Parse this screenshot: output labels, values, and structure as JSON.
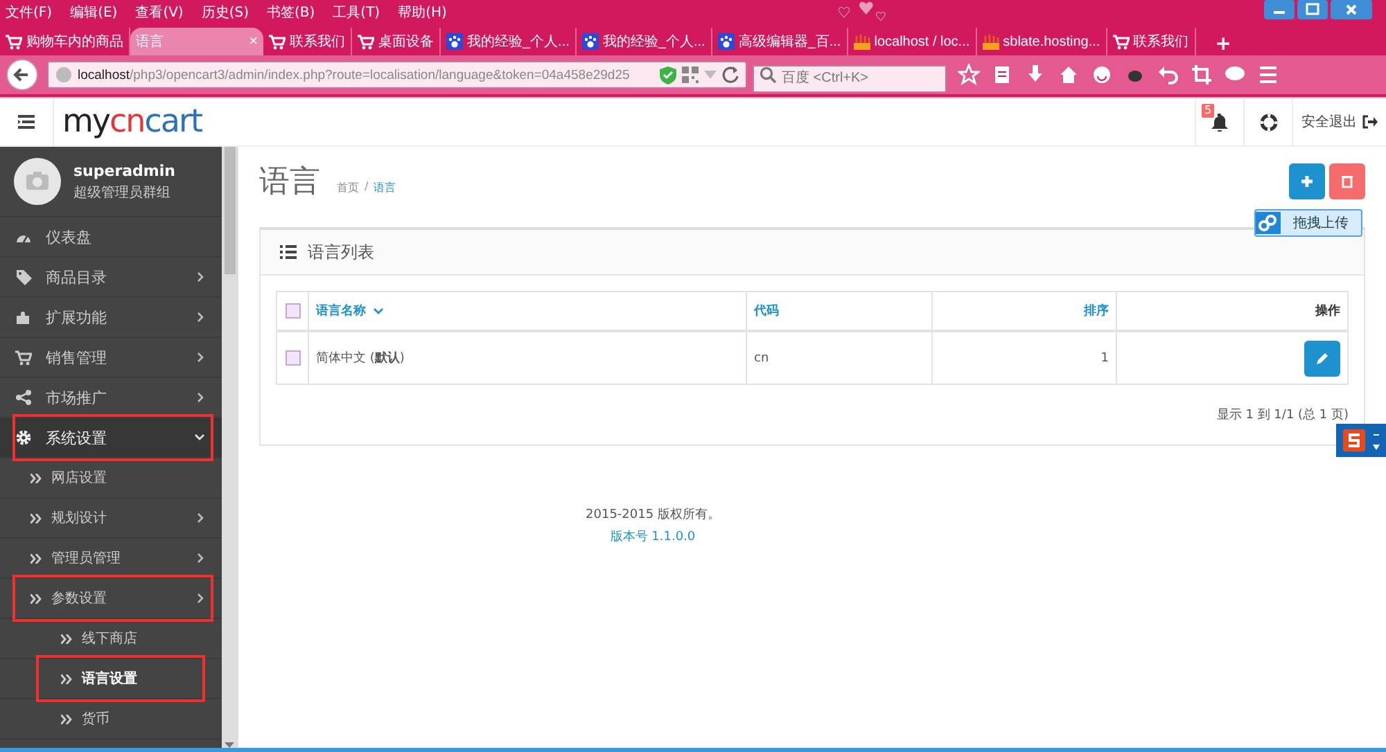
{
  "browser": {
    "menu": [
      "文件(F)",
      "编辑(E)",
      "查看(V)",
      "历史(S)",
      "书签(B)",
      "工具(T)",
      "帮助(H)"
    ],
    "tabs": [
      {
        "label": "购物车内的商品",
        "kind": "shop",
        "selected": false
      },
      {
        "label": "语言",
        "kind": "plain",
        "selected": true,
        "close": "×"
      },
      {
        "label": "联系我们",
        "kind": "shop",
        "selected": false
      },
      {
        "label": "桌面设备",
        "kind": "shop",
        "selected": false
      },
      {
        "label": "我的经验_个人...",
        "kind": "baidu",
        "selected": false
      },
      {
        "label": "我的经验_个人...",
        "kind": "baidu",
        "selected": false
      },
      {
        "label": "高级编辑器_百...",
        "kind": "baidu",
        "selected": false
      },
      {
        "label": "localhost / loc...",
        "kind": "admin",
        "selected": false
      },
      {
        "label": "sblate.hosting...",
        "kind": "admin",
        "selected": false
      },
      {
        "label": "联系我们",
        "kind": "shop",
        "selected": false
      }
    ],
    "new_tab": "+",
    "address": {
      "host": "localhost",
      "path": "/php3/opencart3/admin/index.php?route=localisation/language&token=04a458e29d25"
    },
    "search": {
      "placeholder": "百度 <Ctrl+K>"
    }
  },
  "header": {
    "logo": [
      {
        "text": "my",
        "color": "#222222"
      },
      {
        "text": "cn",
        "color": "#e8343a"
      },
      {
        "text": "cart",
        "color": "#2a73b8"
      }
    ],
    "notifications": "5",
    "logout": "安全退出"
  },
  "sidebar": {
    "user": {
      "name": "superadmin",
      "group": "超级管理员群组"
    },
    "items": [
      {
        "label": "仪表盘",
        "expanded": false,
        "highlighted": false,
        "has_children": false
      },
      {
        "label": "商品目录",
        "expanded": false,
        "highlighted": false,
        "has_children": true
      },
      {
        "label": "扩展功能",
        "expanded": false,
        "highlighted": false,
        "has_children": true
      },
      {
        "label": "销售管理",
        "expanded": false,
        "highlighted": false,
        "has_children": true
      },
      {
        "label": "市场推广",
        "expanded": false,
        "highlighted": false,
        "has_children": true
      },
      {
        "label": "系统设置",
        "expanded": true,
        "highlighted": true,
        "has_children": true,
        "children": [
          {
            "label": "网店设置",
            "expanded": false,
            "highlighted": false,
            "has_children": false,
            "selected": false
          },
          {
            "label": "规划设计",
            "expanded": false,
            "highlighted": false,
            "has_children": true,
            "selected": false
          },
          {
            "label": "管理员管理",
            "expanded": false,
            "highlighted": false,
            "has_children": true,
            "selected": false
          },
          {
            "label": "参数设置",
            "expanded": true,
            "highlighted": true,
            "has_children": true,
            "selected": false,
            "children": [
              {
                "label": "线下商店",
                "highlighted": false,
                "selected": false
              },
              {
                "label": "语言设置",
                "highlighted": true,
                "selected": true
              },
              {
                "label": "货币",
                "highlighted": false,
                "selected": false
              }
            ]
          }
        ]
      }
    ]
  },
  "page": {
    "title": "语言",
    "breadcrumb_separator": "/",
    "breadcrumb": [
      {
        "label": "首页",
        "selected": false
      },
      {
        "label": "语言",
        "selected": true
      }
    ],
    "upload_widget": "拖拽上传",
    "panel": {
      "title": "语言列表",
      "table": {
        "select_all_checked": false,
        "columns": [
          {
            "label": "语言名称",
            "sort": true,
            "kind": "text"
          },
          {
            "label": "代码",
            "sort": false,
            "kind": "text"
          },
          {
            "label": "排序",
            "sort": false,
            "kind": "number"
          },
          {
            "label": "操作",
            "sort": false,
            "kind": "action"
          }
        ],
        "rows": [
          {
            "checked": false,
            "cells": [
              "简体中文 (**默认**)",
              "cn",
              "1"
            ]
          }
        ]
      },
      "pagination": "显示 1 到 1/1 (总 1 页)"
    }
  },
  "footer": {
    "copyright": "2015-2015 版权所有。",
    "version": "版本号 1.1.0.0"
  }
}
